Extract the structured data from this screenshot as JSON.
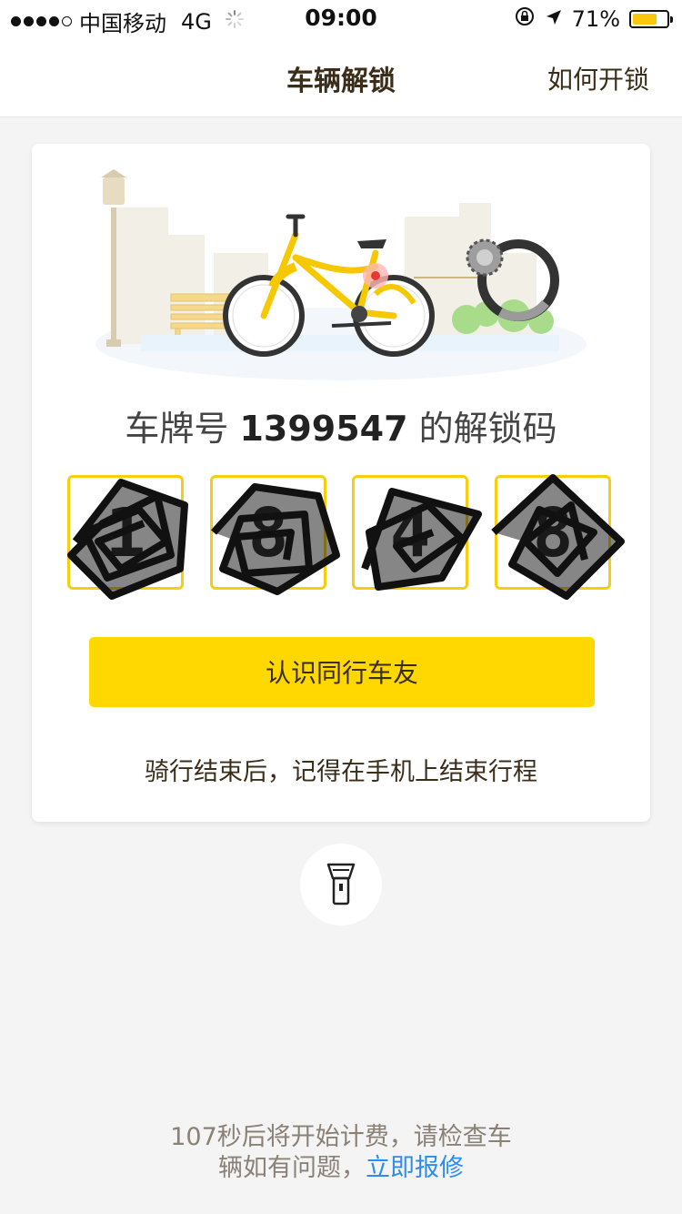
{
  "status": {
    "carrier": "中国移动",
    "network": "4G",
    "time": "09:00",
    "battery": "71%",
    "battery_level": 0.71
  },
  "nav": {
    "title": "车辆解锁",
    "right_link": "如何开锁"
  },
  "card": {
    "plate_prefix": "车牌号",
    "plate_number": "1399547",
    "plate_suffix": "的解锁码",
    "code": [
      "1",
      "8",
      "4",
      "8"
    ],
    "button_label": "认识同行车友",
    "hint": "骑行结束后，记得在手机上结束行程"
  },
  "bottom": {
    "line1": "107秒后将开始计费，请检查车",
    "line2": "辆如有问题，",
    "link": "立即报修"
  },
  "colors": {
    "accent": "#fed800",
    "box_border": "#f7cd10",
    "link": "#2d8cf0"
  },
  "icons": {
    "lock_rotation": "lock-rotation-icon",
    "location": "location-arrow-icon",
    "flashlight": "flashlight-icon",
    "loading": "loading-spinner-icon"
  }
}
